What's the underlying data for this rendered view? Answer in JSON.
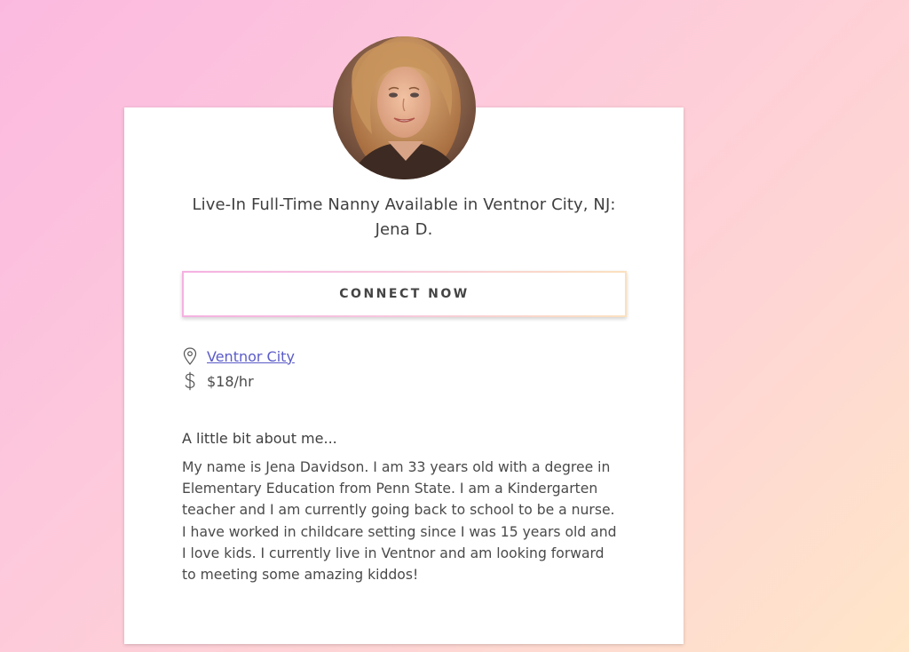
{
  "profile": {
    "title_line1": "Live-In Full-Time Nanny Available in Ventnor City, NJ:",
    "title_line2": "Jena D.",
    "photo_icon": "profile-photo",
    "connect_label": "CONNECT NOW",
    "location": {
      "icon": "map-pin-icon",
      "text": "Ventnor City"
    },
    "rate": {
      "icon": "dollar-icon",
      "text": "$18/hr"
    },
    "about_heading": "A little bit about me...",
    "about_lines": [
      "My name is Jena Davidson. I am 33 years old with a degree in",
      "Elementary Education from Penn State. I am a Kindergarten",
      "teacher and I am currently going back to school to be a nurse.",
      "I have worked in childcare setting since I was 15 years old and",
      "I love kids. I currently live in Ventnor and am looking forward",
      "to meeting some amazing kiddos!"
    ]
  },
  "colors": {
    "link": "#5b5bc9",
    "text": "#4a4a4a",
    "background_start": "#fbb9df",
    "background_end": "#ffe6c8"
  }
}
